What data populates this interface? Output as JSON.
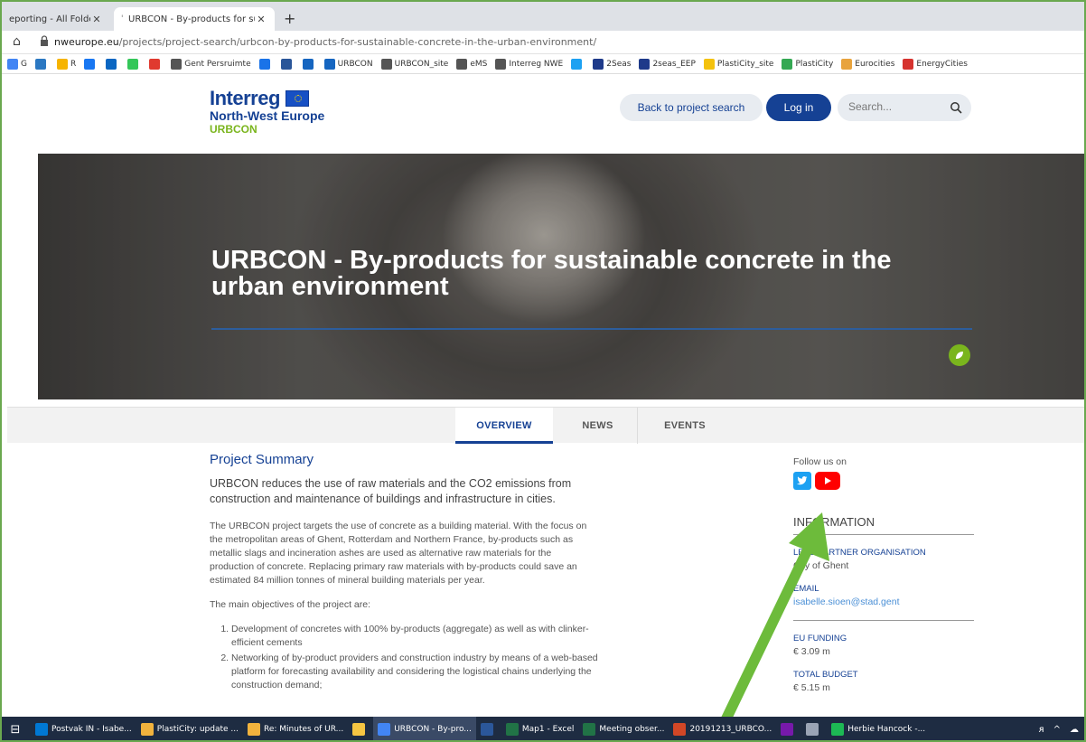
{
  "browser": {
    "tabs": [
      {
        "title": "eporting - All Folders",
        "active": false
      },
      {
        "title": "URBCON - By-products for susta",
        "active": true
      }
    ],
    "new_tab": "+",
    "url_host": "nweurope.eu",
    "url_path": "/projects/project-search/urbcon-by-products-for-sustainable-concrete-in-the-urban-environment/",
    "bookmarks": [
      {
        "label": "G",
        "color": "#4285f4"
      },
      {
        "label": "",
        "color": "#2b78c2"
      },
      {
        "label": "R",
        "color": "#f6b400"
      },
      {
        "label": "",
        "color": "#1877f2"
      },
      {
        "label": "",
        "color": "#0a66c2"
      },
      {
        "label": "",
        "color": "#34c759"
      },
      {
        "label": "",
        "color": "#e03a2f"
      },
      {
        "label": "Gent Persruimte",
        "color": "#555555"
      },
      {
        "label": "",
        "color": "#1a73e8"
      },
      {
        "label": "",
        "color": "#2a5699"
      },
      {
        "label": "",
        "color": "#1565c0"
      },
      {
        "label": "URBCON",
        "color": "#1565c0"
      },
      {
        "label": "URBCON_site",
        "color": "#555555"
      },
      {
        "label": "eMS",
        "color": "#555555"
      },
      {
        "label": "Interreg NWE",
        "color": "#555555"
      },
      {
        "label": "",
        "color": "#1da1f2"
      },
      {
        "label": "2Seas",
        "color": "#1e3a8a"
      },
      {
        "label": "2seas_EEP",
        "color": "#1e3a8a"
      },
      {
        "label": "PlastiCity_site",
        "color": "#f4c20d"
      },
      {
        "label": "PlastiCity",
        "color": "#34a853"
      },
      {
        "label": "Eurocities",
        "color": "#e8a33d"
      },
      {
        "label": "EnergyCities",
        "color": "#d6332f"
      }
    ]
  },
  "header": {
    "logo_line1": "Interreg",
    "logo_line2": "North-West Europe",
    "logo_line3": "URBCON",
    "back_label": "Back to project search",
    "login_label": "Log in",
    "search_placeholder": "Search..."
  },
  "hero": {
    "title": "URBCON - By-products for sustainable concrete in the urban environment"
  },
  "nav": {
    "tabs": [
      "OVERVIEW",
      "NEWS",
      "EVENTS"
    ]
  },
  "summary": {
    "heading": "Project Summary",
    "lead": "URBCON reduces the use of raw materials and the CO2 emissions from construction and maintenance of buildings and infrastructure in cities.",
    "para": "The URBCON project targets the use of concrete as a building material. With the focus on the metropolitan areas of Ghent, Rotterdam and Northern France, by-products such as metallic slags and incineration ashes are used as alternative raw materials for the production of concrete. Replacing primary raw materials with by-products could save an estimated 84 million tonnes of mineral building materials per year.",
    "objectives_intro": "The main objectives of the project are:",
    "objectives": [
      "Development of concretes with 100% by-products (aggregate) as well as with clinker-efficient cements",
      "Networking of by-product providers and construction industry by means of a web-based platform for forecasting availability and considering the logistical chains underlying the construction demand;"
    ]
  },
  "sidebar": {
    "follow": "Follow us on",
    "info_title": "INFORMATION",
    "lead_partner_label": "LEAD PARTNER ORGANISATION",
    "lead_partner_value": "City of Ghent",
    "email_label": "EMAIL",
    "email_value": "isabelle.sioen@stad.gent",
    "eu_funding_label": "EU FUNDING",
    "eu_funding_value": "€ 3.09 m",
    "total_budget_label": "TOTAL BUDGET",
    "total_budget_value": "€ 5.15 m"
  },
  "taskbar": {
    "items": [
      {
        "label": "Postvak IN - Isabe...",
        "color": "#0078d4"
      },
      {
        "label": "PlastiCity: update ...",
        "color": "#f2b33d"
      },
      {
        "label": "Re: Minutes of UR...",
        "color": "#f2b33d"
      },
      {
        "label": "",
        "color": "#f5c542"
      },
      {
        "label": "URBCON - By-pro...",
        "color": "#4285f4",
        "active": true
      },
      {
        "label": "",
        "color": "#2b579a"
      },
      {
        "label": "Map1 - Excel",
        "color": "#217346"
      },
      {
        "label": "Meeting obser...",
        "color": "#217346"
      },
      {
        "label": "20191213_URBCO...",
        "color": "#d24726"
      },
      {
        "label": "",
        "color": "#7719aa"
      },
      {
        "label": "",
        "color": "#9aa4b5"
      },
      {
        "label": "Herbie Hancock -...",
        "color": "#1db954"
      }
    ]
  },
  "colors": {
    "brand_blue": "#154194",
    "brand_green": "#7ab51d",
    "annotation_arrow": "#6dbb3b"
  }
}
